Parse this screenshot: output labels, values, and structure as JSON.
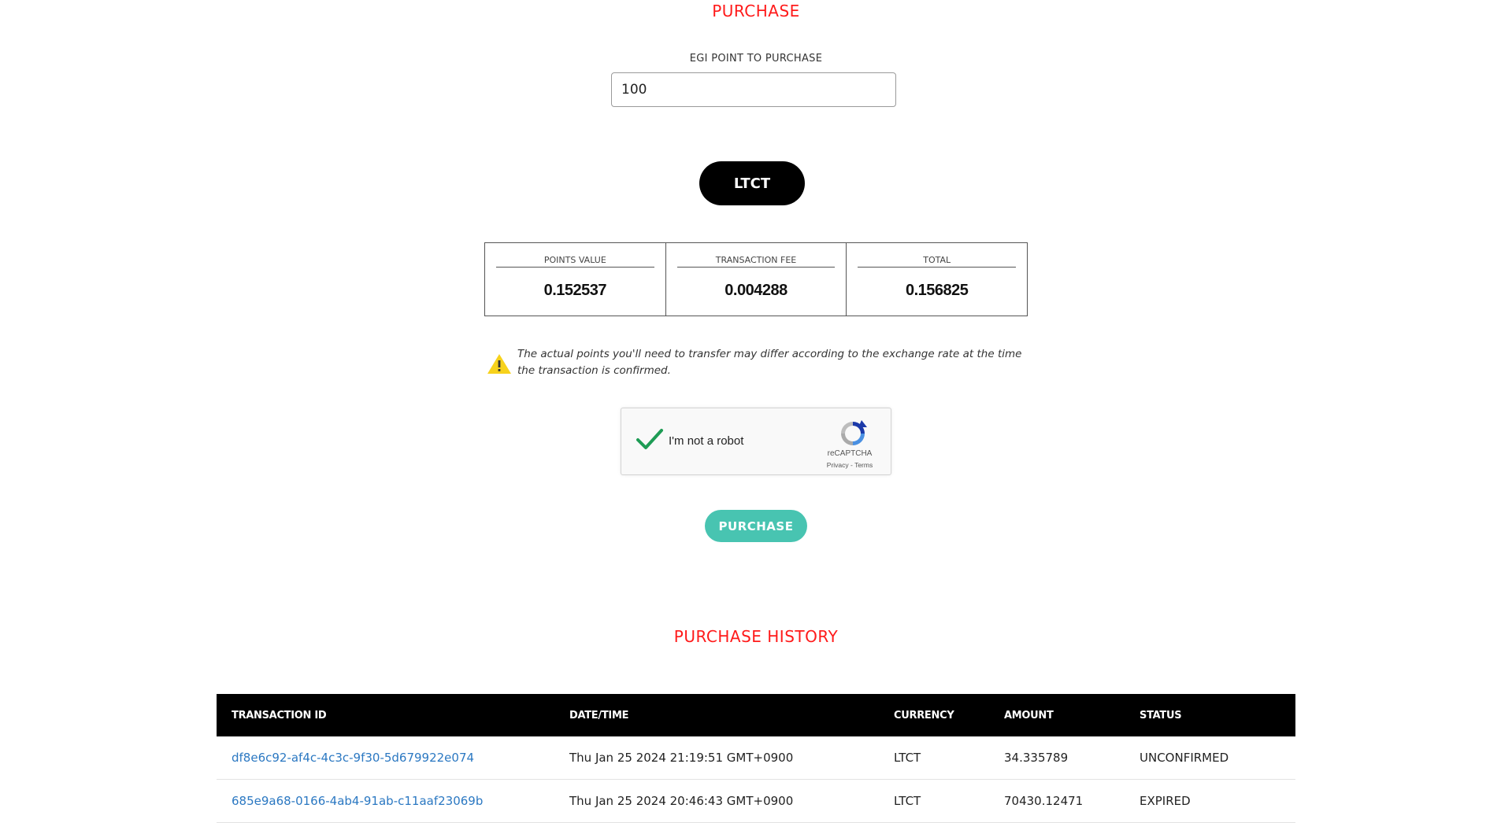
{
  "purchase": {
    "title": "PURCHASE",
    "points_label": "EGI POINT TO PURCHASE",
    "points_value": "100",
    "currency_button": "LTCT",
    "summary": [
      {
        "label": "POINTS VALUE",
        "value": "0.152537"
      },
      {
        "label": "TRANSACTION FEE",
        "value": "0.004288"
      },
      {
        "label": "TOTAL",
        "value": "0.156825"
      }
    ],
    "notice": "The actual points you'll need to transfer may differ according to the exchange rate at the time the transaction is confirmed.",
    "captcha": {
      "text": "I'm not a robot",
      "brand": "reCAPTCHA",
      "privacy": "Privacy",
      "separator": " - ",
      "terms": "Terms",
      "checked": true
    },
    "submit_button": "PURCHASE"
  },
  "history": {
    "title": "PURCHASE HISTORY",
    "columns": [
      "TRANSACTION ID",
      "DATE/TIME",
      "CURRENCY",
      "AMOUNT",
      "STATUS"
    ],
    "rows": [
      {
        "id": "df8e6c92-af4c-4c3c-9f30-5d679922e074",
        "datetime": "Thu Jan 25 2024 21:19:51 GMT+0900",
        "currency": "LTCT",
        "amount": "34.335789",
        "status": "UNCONFIRMED"
      },
      {
        "id": "685e9a68-0166-4ab4-91ab-c11aaf23069b",
        "datetime": "Thu Jan 25 2024 20:46:43 GMT+0900",
        "currency": "LTCT",
        "amount": "70430.12471",
        "status": "EXPIRED"
      }
    ]
  },
  "colors": {
    "title_red": "#ff1a1a",
    "purchase_button": "#48c4b1",
    "link_blue": "#2b78c2",
    "header_black": "#000000"
  },
  "icons": {
    "warning": "warning-icon",
    "checkmark": "checkmark-icon",
    "recaptcha": "recaptcha-logo-icon"
  }
}
